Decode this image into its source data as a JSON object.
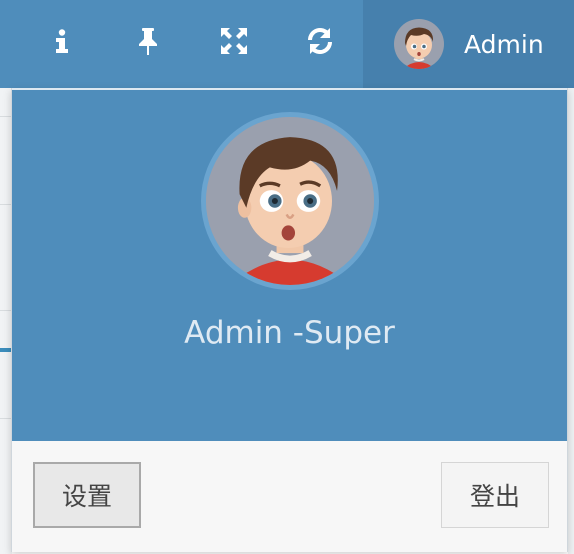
{
  "navbar": {
    "background": "#4f8dbb",
    "icons": [
      "info-icon",
      "pin-icon",
      "fullscreen-icon",
      "refresh-icon"
    ],
    "username": "Admin"
  },
  "dropdown": {
    "header_background": "#4f8dbb",
    "user_title": "Admin -Super",
    "settings_label": "设置",
    "logout_label": "登出"
  }
}
